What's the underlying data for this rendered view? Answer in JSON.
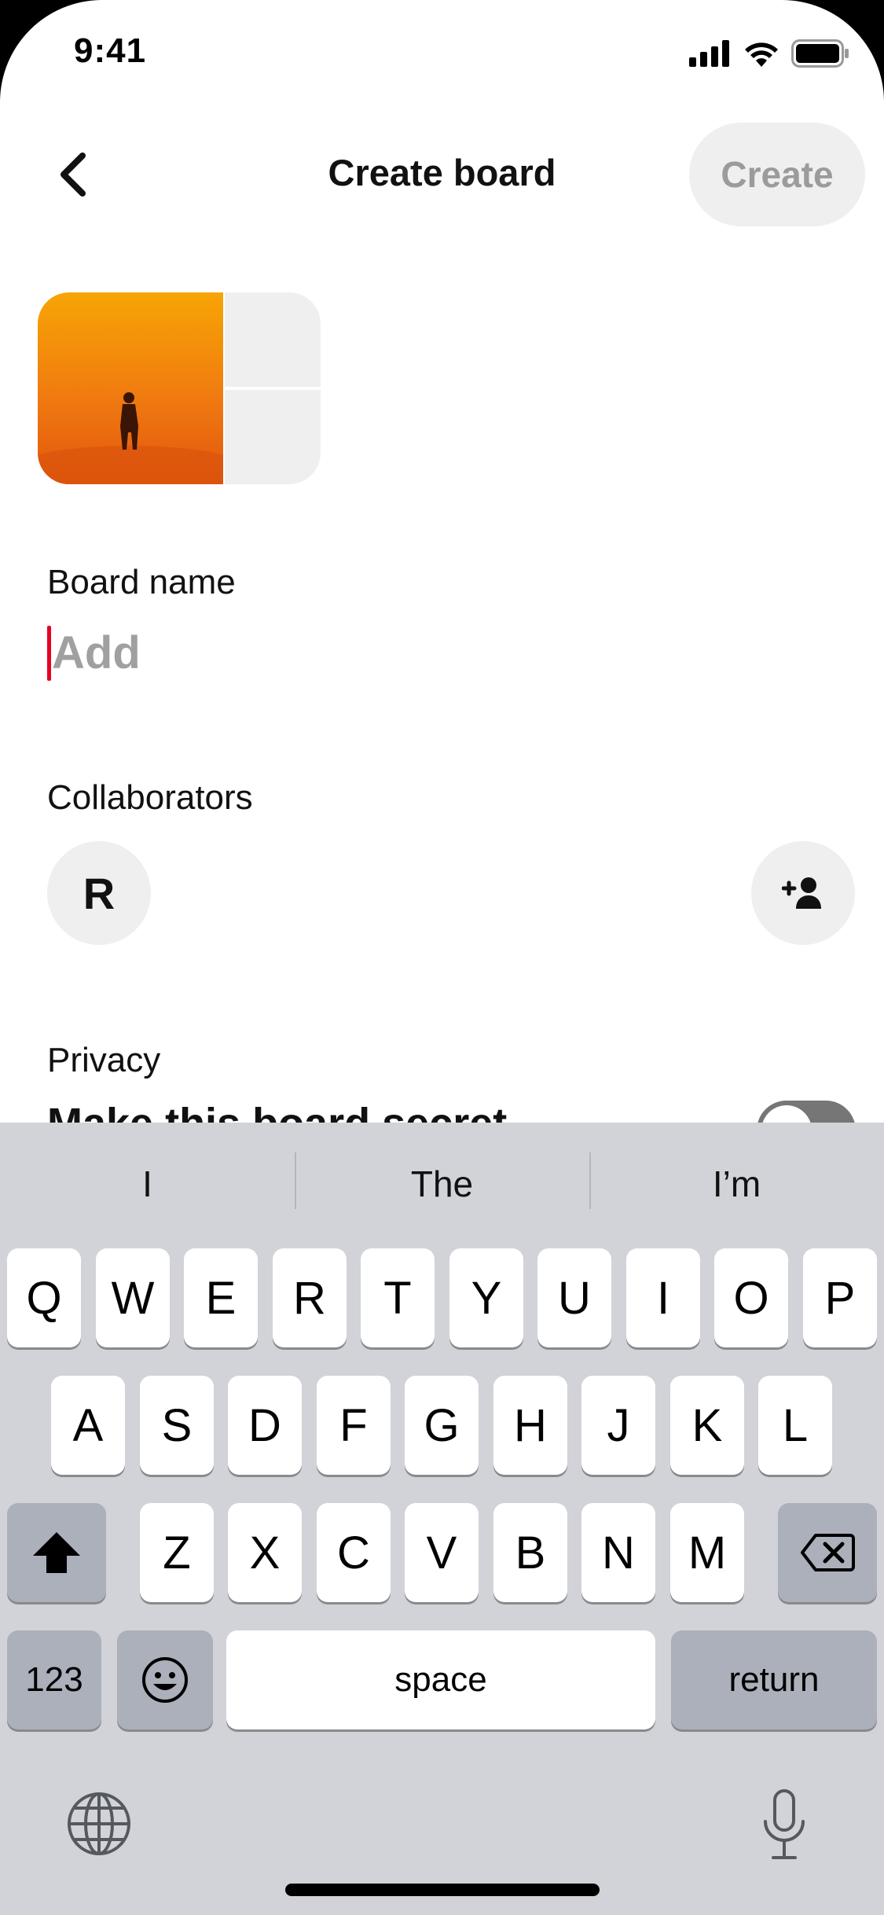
{
  "status_bar": {
    "time": "9:41"
  },
  "header": {
    "title": "Create board",
    "create_label": "Create"
  },
  "form": {
    "board_name_label": "Board name",
    "board_name_placeholder": "Add",
    "board_name_value": "",
    "collaborators_label": "Collaborators",
    "collaborator_initial": "R",
    "privacy_label": "Privacy",
    "secret_label": "Make this board secret",
    "secret_enabled": false
  },
  "keyboard": {
    "suggestions": [
      "I",
      "The",
      "I’m"
    ],
    "row1": [
      "Q",
      "W",
      "E",
      "R",
      "T",
      "Y",
      "U",
      "I",
      "O",
      "P"
    ],
    "row2": [
      "A",
      "S",
      "D",
      "F",
      "G",
      "H",
      "J",
      "K",
      "L"
    ],
    "row3": [
      "Z",
      "X",
      "C",
      "V",
      "B",
      "N",
      "M"
    ],
    "numbers_label": "123",
    "space_label": "space",
    "return_label": "return"
  },
  "colors": {
    "accent_caret": "#e60023",
    "keyboard_bg": "#d1d3d9"
  },
  "icons": [
    "signal-icon",
    "wifi-icon",
    "battery-icon",
    "back-chevron-icon",
    "add-person-icon",
    "shift-icon",
    "delete-icon",
    "emoji-icon",
    "globe-icon",
    "mic-icon"
  ]
}
